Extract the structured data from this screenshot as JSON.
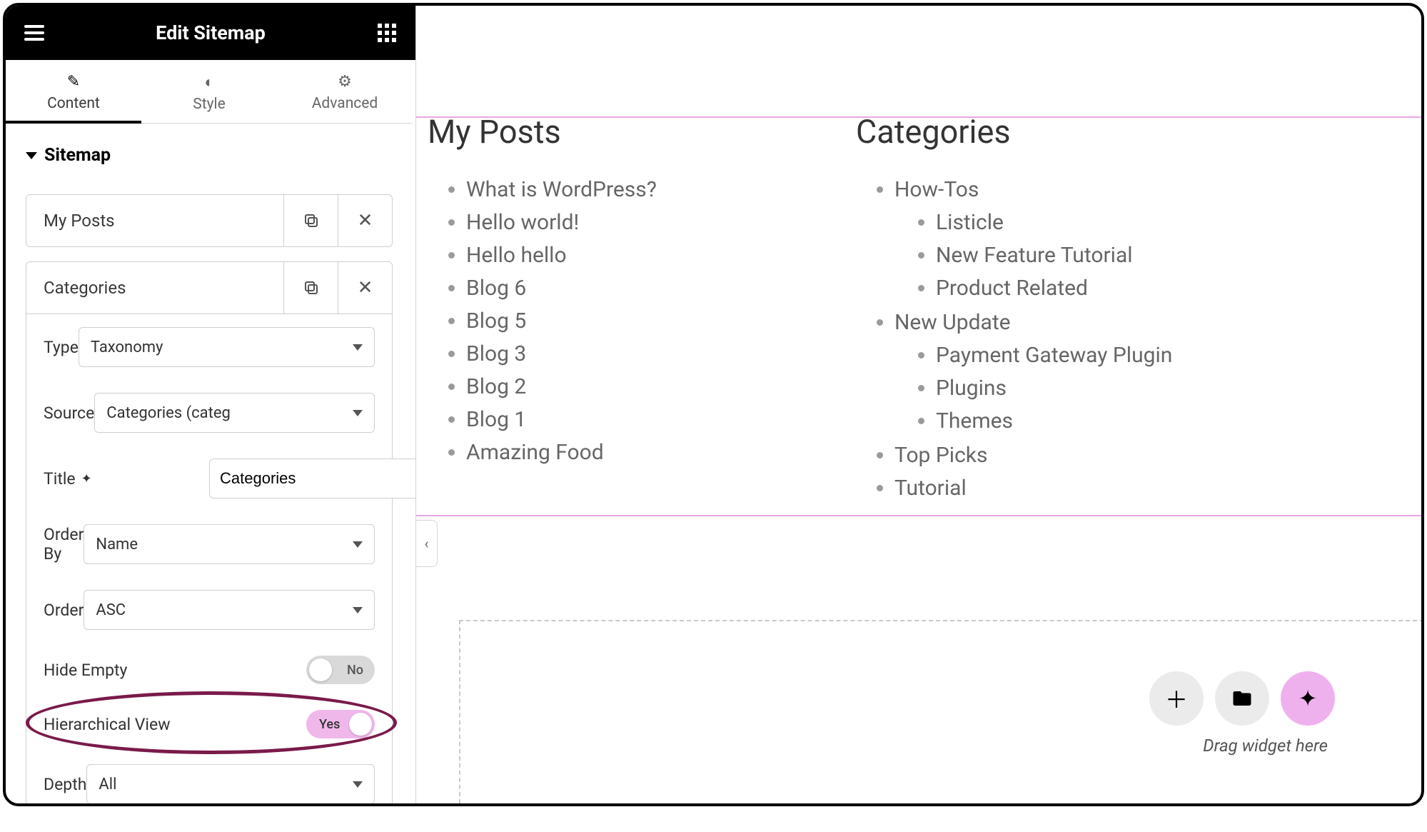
{
  "header": {
    "title": "Edit Sitemap"
  },
  "tabs": {
    "content": "Content",
    "style": "Style",
    "advanced": "Advanced"
  },
  "section": {
    "title": "Sitemap"
  },
  "items": [
    {
      "title": "My Posts"
    },
    {
      "title": "Categories"
    }
  ],
  "fields": {
    "type": {
      "label": "Type",
      "value": "Taxonomy"
    },
    "source": {
      "label": "Source",
      "value": "Categories (categ"
    },
    "title": {
      "label": "Title",
      "value": "Categories"
    },
    "orderby": {
      "label": "Order By",
      "value": "Name"
    },
    "order": {
      "label": "Order",
      "value": "ASC"
    },
    "hideempty": {
      "label": "Hide Empty",
      "value": "No"
    },
    "hierarchical": {
      "label": "Hierarchical View",
      "value": "Yes"
    },
    "depth": {
      "label": "Depth",
      "value": "All"
    }
  },
  "preview": {
    "posts_heading": "My Posts",
    "cats_heading": "Categories",
    "posts": [
      "What is WordPress?",
      "Hello world!",
      "Hello hello",
      "Blog 6",
      "Blog 5",
      "Blog 3",
      "Blog 2",
      "Blog 1",
      "Amazing Food"
    ],
    "cats": [
      {
        "name": "How-Tos",
        "children": [
          "Listicle",
          "New Feature Tutorial",
          "Product Related"
        ]
      },
      {
        "name": "New Update",
        "children": [
          "Payment Gateway Plugin",
          "Plugins",
          "Themes"
        ]
      },
      {
        "name": "Top Picks",
        "children": []
      },
      {
        "name": "Tutorial",
        "children": []
      }
    ],
    "dropzone": "Drag widget here"
  }
}
